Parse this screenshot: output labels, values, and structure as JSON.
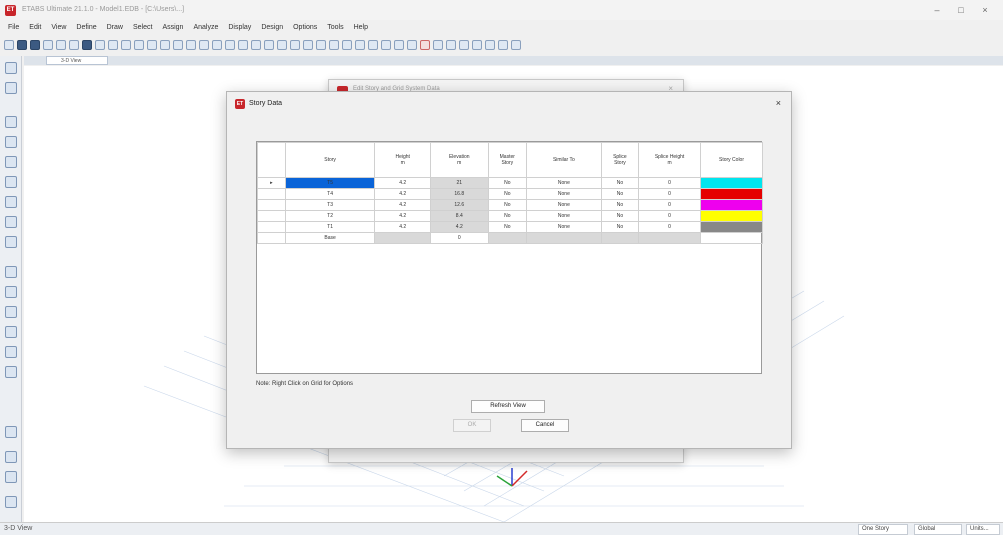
{
  "app": {
    "window_title": "ETABS Ultimate 21.1.0 - Model1.EDB - [C:\\Users\\...]",
    "window_controls": [
      "–",
      "□",
      "×"
    ]
  },
  "menu": [
    "File",
    "Edit",
    "View",
    "Define",
    "Draw",
    "Select",
    "Assign",
    "Analyze",
    "Display",
    "Design",
    "Options",
    "Tools",
    "Help"
  ],
  "view_tab": "3-D View",
  "background_dialog": {
    "title": "Edit Story and Grid System Data"
  },
  "story_dialog": {
    "title": "Story Data",
    "close": "×",
    "columns": [
      "",
      "Story",
      "Height\nm",
      "Elevation\nm",
      "Master\nStory",
      "Similar To",
      "Splice\nStory",
      "Splice Height\nm",
      "Story Color"
    ],
    "rows": [
      {
        "marker": "▸",
        "story": "T5",
        "height": "4.2",
        "elevation": "21",
        "master": "No",
        "similar": "None",
        "splice": "No",
        "splice_height": "0",
        "color": "#00e5ee"
      },
      {
        "marker": "",
        "story": "T4",
        "height": "4.2",
        "elevation": "16.8",
        "master": "No",
        "similar": "None",
        "splice": "No",
        "splice_height": "0",
        "color": "#e50000"
      },
      {
        "marker": "",
        "story": "T3",
        "height": "4.2",
        "elevation": "12.6",
        "master": "No",
        "similar": "None",
        "splice": "No",
        "splice_height": "0",
        "color": "#ee00ee"
      },
      {
        "marker": "",
        "story": "T2",
        "height": "4.2",
        "elevation": "8.4",
        "master": "No",
        "similar": "None",
        "splice": "No",
        "splice_height": "0",
        "color": "#ffff00"
      },
      {
        "marker": "",
        "story": "T1",
        "height": "4.2",
        "elevation": "4.2",
        "master": "No",
        "similar": "None",
        "splice": "No",
        "splice_height": "0",
        "color": "#888888"
      }
    ],
    "base_row": {
      "story": "Base",
      "elevation": "0"
    },
    "note": "Note: Right Click on Grid for Options",
    "refresh_button": "Refresh View",
    "ok_button": "OK",
    "cancel_button": "Cancel"
  },
  "statusbar": {
    "left": "3-D View",
    "story_dropdown": "One Story",
    "global_dropdown": "Global",
    "units_dropdown": "Units..."
  }
}
